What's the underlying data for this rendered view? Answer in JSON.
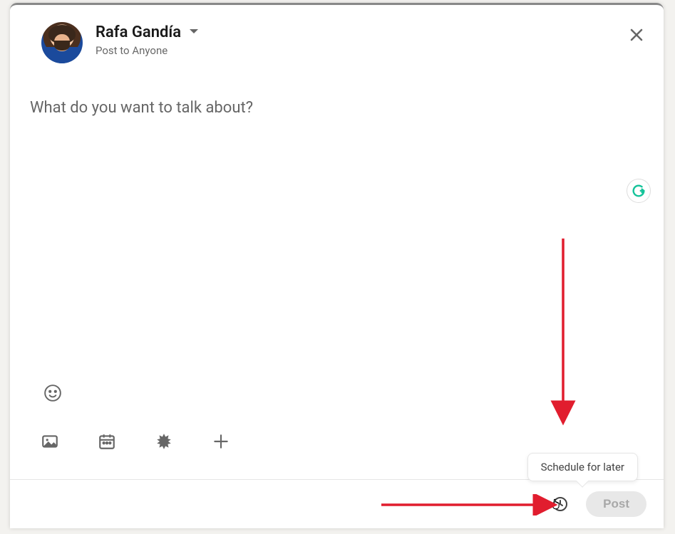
{
  "header": {
    "user_name": "Rafa Gandía",
    "visibility_label": "Post to Anyone"
  },
  "composer": {
    "placeholder": "What do you want to talk about?",
    "value": ""
  },
  "icons": {
    "emoji": "emoji-icon",
    "media": "image-icon",
    "event": "calendar-icon",
    "celebrate": "starburst-icon",
    "more": "plus-icon",
    "grammarly": "grammarly-icon",
    "close": "close-icon",
    "schedule": "clock-icon",
    "chevron": "chevron-down-icon"
  },
  "tooltip": {
    "schedule_label": "Schedule for later"
  },
  "footer": {
    "post_label": "Post"
  },
  "colors": {
    "arrow": "#e11d2e",
    "grammarly": "#15c39a",
    "muted": "#666666",
    "disabled_bg": "#e8e8e8",
    "disabled_text": "#a8a8a8"
  }
}
